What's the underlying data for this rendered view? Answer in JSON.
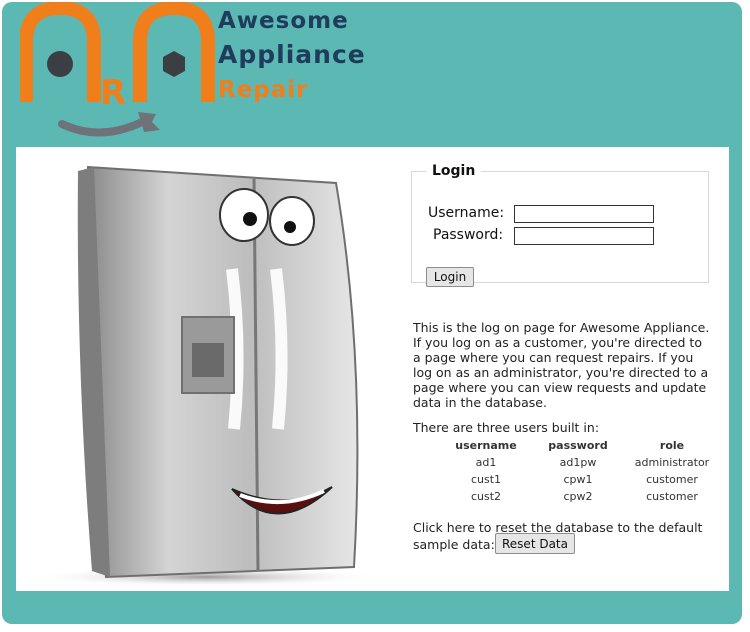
{
  "brand": {
    "logo_letters": "ARA",
    "line1": "Awesome",
    "line2": "Appliance",
    "line3": "Repair"
  },
  "colors": {
    "frame": "#5cb8b3",
    "brand_orange": "#f07e1a",
    "brand_navy": "#1f3c5c"
  },
  "login": {
    "legend": "Login",
    "username_label": "Username:",
    "password_label": "Password:",
    "username_value": "",
    "password_value": "",
    "button_label": "Login"
  },
  "description": "This is the log on page for Awesome Appliance. If you log on as a customer, you're directed to a page where you can request repairs. If you log on as an administrator, you're directed to a page where you can view requests and update data in the database.",
  "users": {
    "intro": "There are three users built in:",
    "headers": [
      "username",
      "password",
      "role"
    ],
    "rows": [
      [
        "ad1",
        "ad1pw",
        "administrator"
      ],
      [
        "cust1",
        "cpw1",
        "customer"
      ],
      [
        "cust2",
        "cpw2",
        "customer"
      ]
    ]
  },
  "reset": {
    "text": "Click here to reset the database to the default sample data:",
    "button_label": "Reset Data"
  },
  "icons": [
    "wrench-icon",
    "bolt-icon",
    "fridge-mascot-illustration"
  ]
}
